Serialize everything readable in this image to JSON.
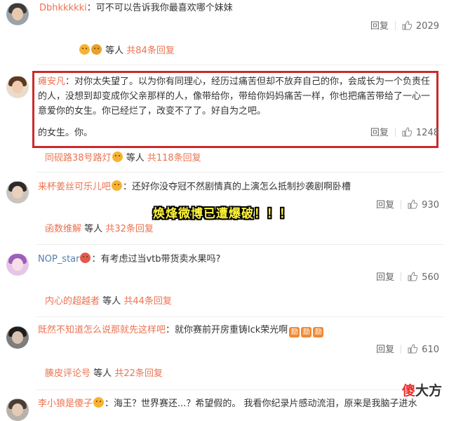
{
  "comments": [
    {
      "username": "Dbhkkkkki",
      "text": "：可不可以告诉我你最喜欢哪个妹妹",
      "reply_label": "回复",
      "likes": "2029",
      "sub_prefix": "等人",
      "sub_count": "共84条回复"
    },
    {
      "username": "瘫安凡",
      "line1": "：对你太失望了。以为你有同理心，经历过痛苦但却不放弃自己的你，会成长为一个负责任",
      "line2": "的人，没想到却变成你父亲那样的人，像带给你，带给你妈妈痛苦一样，你也把痛苦带给了一心一",
      "line3": "意爱你的女生。你已经烂了，改变不了了。好自为之吧。",
      "line4": "的女生。你。",
      "reply_label": "回复",
      "likes": "1248",
      "sub_user": "同砚路38号路灯",
      "sub_prefix": "等人",
      "sub_count": "共118条回复"
    },
    {
      "username": "来杯姜丝可乐儿吧",
      "text": "：还好你没夺冠不然剧情真的上演怎么抵制抄袭剧啊卧槽",
      "reply_label": "回复",
      "likes": "930",
      "sub_user": "函数维解",
      "sub_prefix": "等人",
      "sub_count": "共32条回复"
    },
    {
      "username": "NOP_star",
      "text": "：有考虑过当vtb带货卖水果吗?",
      "reply_label": "回复",
      "likes": "560",
      "sub_user": "内心的超越者",
      "sub_prefix": "等人",
      "sub_count": "共44条回复"
    },
    {
      "username": "既然不知道怎么说那就先这样吧",
      "text": "：就你赛前开房重铸lck荣光啊",
      "badge": "励",
      "reply_label": "回复",
      "likes": "610",
      "sub_user": "腠皮评论号",
      "sub_prefix": "等人",
      "sub_count": "共22条回复"
    },
    {
      "username": "李小狼是傻子",
      "text": "：海王？世界赛还...？希望假的。  我看你纪录片感动流泪，原来是我脑子进水"
    }
  ],
  "banner": "焕烽微博已遭爆破！！！",
  "watermark_first": "傻",
  "watermark_rest": "大方",
  "colors": {
    "username": "#eb7350",
    "link": "#507daf",
    "highlight": "#cc2a2a",
    "banner": "#fff53a"
  },
  "icons": [
    "like-thumb-icon",
    "emoji-icon",
    "avatar"
  ]
}
